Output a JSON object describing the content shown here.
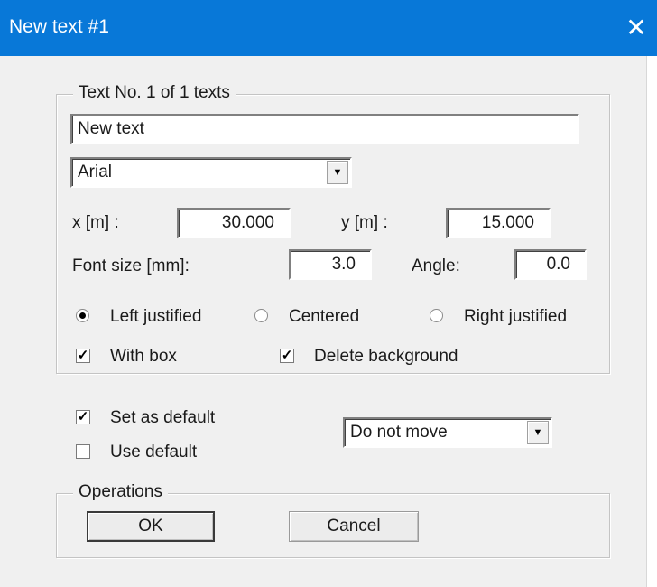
{
  "window": {
    "title": "New text  #1",
    "close_icon": "✕"
  },
  "text_group": {
    "legend": "Text  No. 1  of  1 texts",
    "text_value": "New text",
    "font_value": "Arial",
    "x_label": "x [m] :",
    "x_value": "30.000",
    "y_label": "y [m] :",
    "y_value": "15.000",
    "font_size_label": "Font size [mm]:",
    "font_size_value": "3.0",
    "angle_label": "Angle:",
    "angle_value": "0.0",
    "justify": {
      "left": "Left justified",
      "center": "Centered",
      "right": "Right justified",
      "selected": "left"
    },
    "with_box": {
      "label": "With box",
      "checked": true
    },
    "delete_background": {
      "label": "Delete background",
      "checked": true
    }
  },
  "defaults": {
    "set_as_default": {
      "label": "Set as default",
      "checked": true
    },
    "use_default": {
      "label": "Use default",
      "checked": false
    },
    "move_value": "Do not move"
  },
  "operations": {
    "legend": "Operations",
    "ok_label": "OK",
    "cancel_label": "Cancel"
  }
}
